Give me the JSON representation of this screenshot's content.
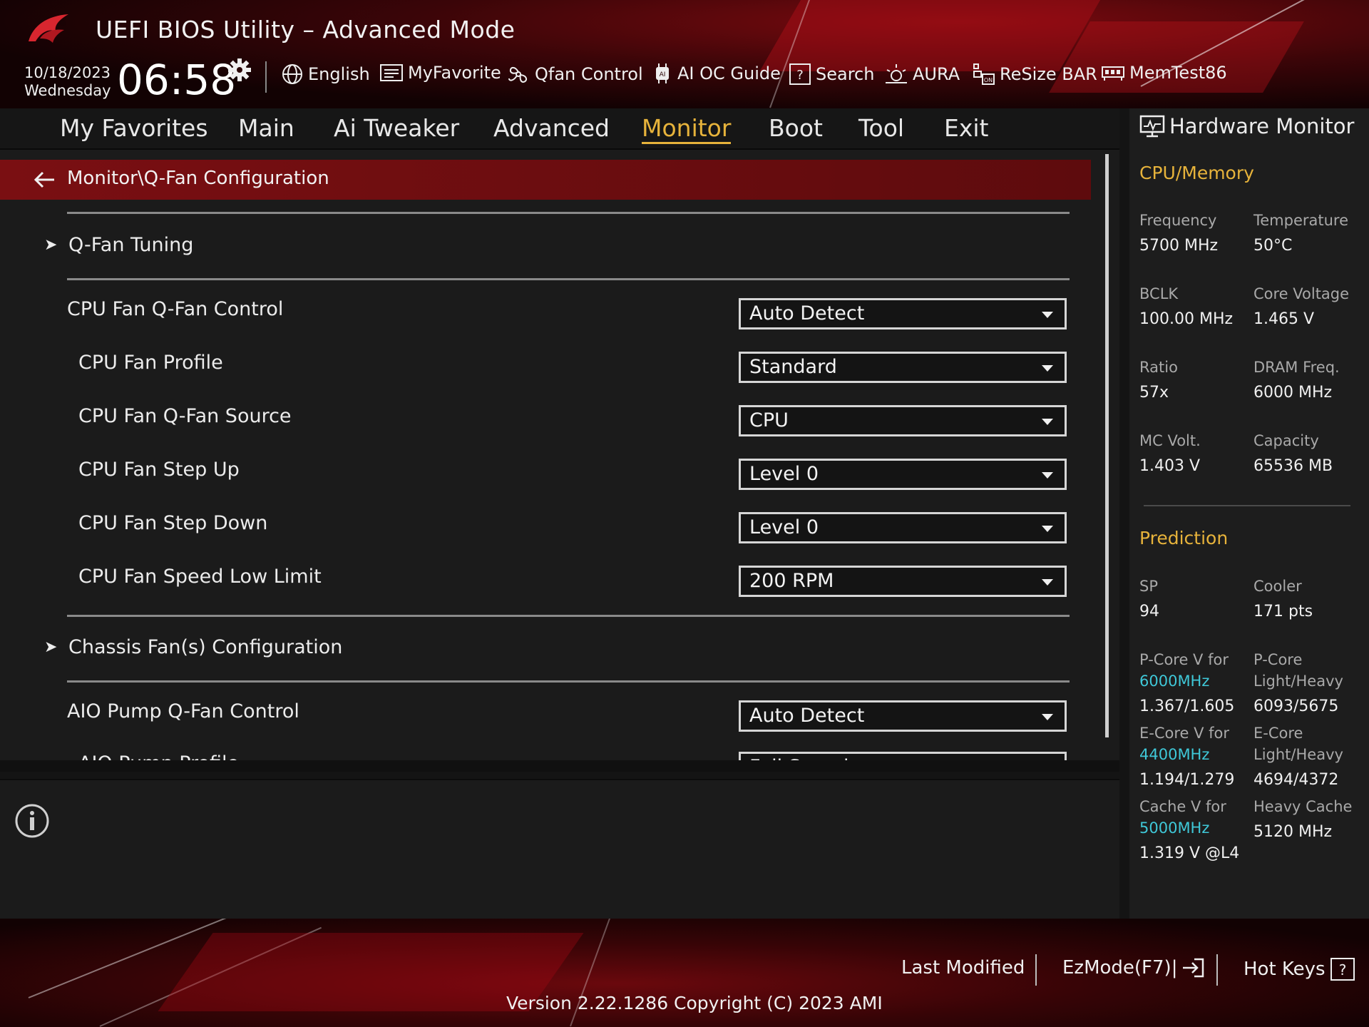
{
  "header": {
    "title": "UEFI BIOS Utility – Advanced Mode",
    "date": "10/18/2023",
    "weekday": "Wednesday",
    "time": "06:58",
    "toolbar": [
      {
        "icon": "globe-icon",
        "label": "English"
      },
      {
        "icon": "favorite-list-icon",
        "label": "MyFavorite"
      },
      {
        "icon": "fan-icon",
        "label": "Qfan Control"
      },
      {
        "icon": "ai-chip-icon",
        "label": "AI OC Guide"
      },
      {
        "icon": "question-box-icon",
        "label": "Search"
      },
      {
        "icon": "aura-light-icon",
        "label": "AURA"
      },
      {
        "icon": "resize-bar-icon",
        "label": "ReSize BAR"
      },
      {
        "icon": "memory-icon",
        "label": "MemTest86"
      }
    ]
  },
  "menu": {
    "items": [
      "My Favorites",
      "Main",
      "Ai Tweaker",
      "Advanced",
      "Monitor",
      "Boot",
      "Tool",
      "Exit"
    ],
    "active": "Monitor"
  },
  "main": {
    "breadcrumb": "Monitor\\Q-Fan Configuration",
    "sections": {
      "qfan_tuning": "Q-Fan Tuning",
      "chassis": "Chassis Fan(s) Configuration"
    },
    "settings": [
      {
        "label": "CPU Fan Q-Fan Control",
        "value": "Auto Detect"
      },
      {
        "label": "CPU Fan Profile",
        "value": "Standard"
      },
      {
        "label": "CPU Fan Q-Fan Source",
        "value": "CPU"
      },
      {
        "label": "CPU Fan Step Up",
        "value": "Level 0"
      },
      {
        "label": "CPU Fan Step Down",
        "value": "Level 0"
      },
      {
        "label": "CPU Fan Speed Low Limit",
        "value": "200 RPM"
      },
      {
        "label": "AIO Pump Q-Fan Control",
        "value": "Auto Detect"
      },
      {
        "label": "AIO Pump Profile",
        "value": "Full Speed"
      }
    ]
  },
  "hardware_monitor": {
    "title": "Hardware Monitor",
    "cpu_memory_heading": "CPU/Memory",
    "cpu_memory": [
      {
        "label": "Frequency",
        "value": "5700 MHz"
      },
      {
        "label": "Temperature",
        "value": "50°C"
      },
      {
        "label": "BCLK",
        "value": "100.00 MHz"
      },
      {
        "label": "Core Voltage",
        "value": "1.465 V"
      },
      {
        "label": "Ratio",
        "value": "57x"
      },
      {
        "label": "DRAM Freq.",
        "value": "6000 MHz"
      },
      {
        "label": "MC Volt.",
        "value": "1.403 V"
      },
      {
        "label": "Capacity",
        "value": "65536 MB"
      }
    ],
    "prediction_heading": "Prediction",
    "prediction": {
      "sp_label": "SP",
      "sp_value": "94",
      "cooler_label": "Cooler",
      "cooler_value": "171 pts",
      "pcore_v_label": "P-Core V for",
      "pcore_v_freq": "6000MHz",
      "pcore_v_value": "1.367/1.605",
      "pcore_lh_label1": "P-Core",
      "pcore_lh_label2": "Light/Heavy",
      "pcore_lh_value": "6093/5675",
      "ecore_v_label": "E-Core V for",
      "ecore_v_freq": "4400MHz",
      "ecore_v_value": "1.194/1.279",
      "ecore_lh_label1": "E-Core",
      "ecore_lh_label2": "Light/Heavy",
      "ecore_lh_value": "4694/4372",
      "cache_v_label": "Cache V for",
      "cache_v_freq": "5000MHz",
      "cache_v_value": "1.319 V @L4",
      "heavy_cache_label": "Heavy Cache",
      "heavy_cache_value": "5120 MHz"
    }
  },
  "footer": {
    "last_modified": "Last Modified",
    "ezmode": "EzMode(F7)|",
    "hotkeys": "Hot Keys",
    "version": "Version 2.22.1286 Copyright (C) 2023 AMI"
  },
  "colors": {
    "accent": "#e7b33b",
    "highlight_bar": "#7a0f12",
    "freq_accent": "#3fc8d8"
  }
}
